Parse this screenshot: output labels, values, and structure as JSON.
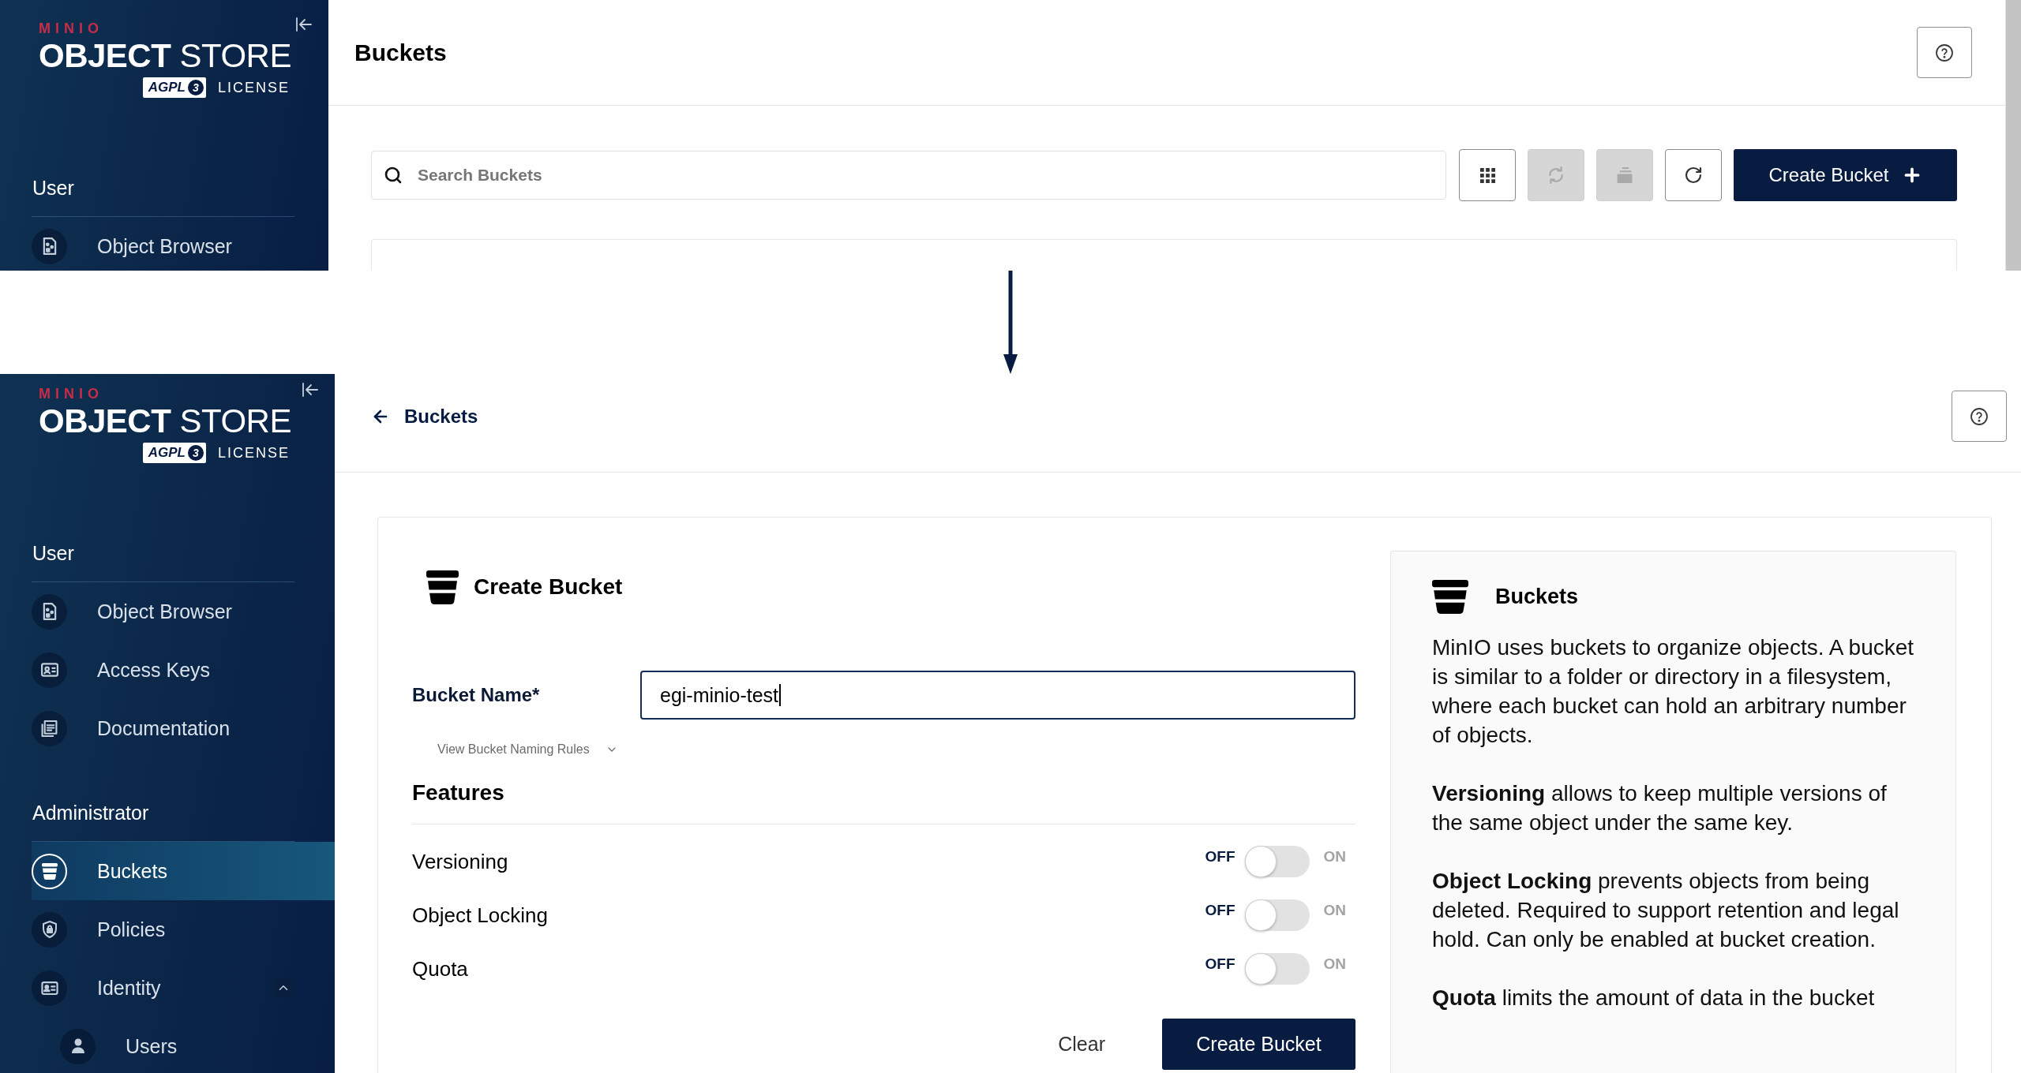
{
  "before_screen": {
    "sidebar": {
      "logo": {
        "brand": "MINIO",
        "product": "**OBJECT** STORE",
        "badge": "AGPL",
        "badge_version": "3",
        "license": "LICENSE"
      },
      "sections": [
        {
          "title": "User",
          "items": [
            {
              "label": "Object Browser",
              "kind": "browser",
              "selected": false
            }
          ]
        }
      ]
    },
    "header": {
      "title": "Buckets"
    },
    "search": {
      "placeholder": "Search Buckets"
    },
    "toolbar": [
      {
        "kind": "grid",
        "disabled": false
      },
      {
        "kind": "sync",
        "disabled": true
      },
      {
        "kind": "stack",
        "disabled": true
      },
      {
        "kind": "refresh",
        "disabled": false
      }
    ],
    "create_button": {
      "label": "Create Bucket"
    }
  },
  "after_screen": {
    "sidebar": {
      "logo": {
        "brand": "MINIO",
        "product": "**OBJECT** STORE",
        "badge": "AGPL",
        "badge_version": "3",
        "license": "LICENSE"
      },
      "sections": [
        {
          "title": "User",
          "items": [
            {
              "label": "Object Browser",
              "kind": "browser",
              "selected": false
            },
            {
              "label": "Access Keys",
              "kind": "keys",
              "selected": false
            },
            {
              "label": "Documentation",
              "kind": "docs",
              "selected": false
            }
          ]
        },
        {
          "title": "Administrator",
          "items": [
            {
              "label": "Buckets",
              "kind": "bucket",
              "selected": true
            },
            {
              "label": "Policies",
              "kind": "policy",
              "selected": false
            },
            {
              "label": "Identity",
              "kind": "identity",
              "selected": false,
              "expanded": true,
              "children": [
                {
                  "label": "Users",
                  "kind": "user",
                  "selected": false
                }
              ]
            }
          ]
        }
      ]
    },
    "header": {
      "back_label": "Buckets"
    },
    "form": {
      "title": "Create Bucket",
      "name_label": "Bucket Name*",
      "name_value": "egi-minio-test",
      "naming_rules": {
        "label": "View Bucket Naming Rules",
        "expanded": false
      },
      "features_title": "Features",
      "features": [
        {
          "label": "Versioning",
          "off_label": "OFF",
          "on_label": "ON",
          "on": false
        },
        {
          "label": "Object Locking",
          "off_label": "OFF",
          "on_label": "ON",
          "on": false
        },
        {
          "label": "Quota",
          "off_label": "OFF",
          "on_label": "ON",
          "on": false
        }
      ],
      "buttons": [
        {
          "kind": "secondary",
          "label": "Clear"
        },
        {
          "kind": "primary",
          "label": "Create Bucket"
        }
      ]
    },
    "info": {
      "title": "Buckets",
      "paragraphs": [
        "MinIO uses buckets to organize objects. A bucket is similar to a folder or directory in a filesystem, where each bucket can hold an arbitrary number of objects.",
        "**Versioning** allows to keep multiple versions of the same object under the same key.",
        "**Object Locking** prevents objects from being deleted. Required to support retention and legal hold. Can only be enabled at bucket creation.",
        "**Quota** limits the amount of data in the bucket"
      ]
    }
  }
}
